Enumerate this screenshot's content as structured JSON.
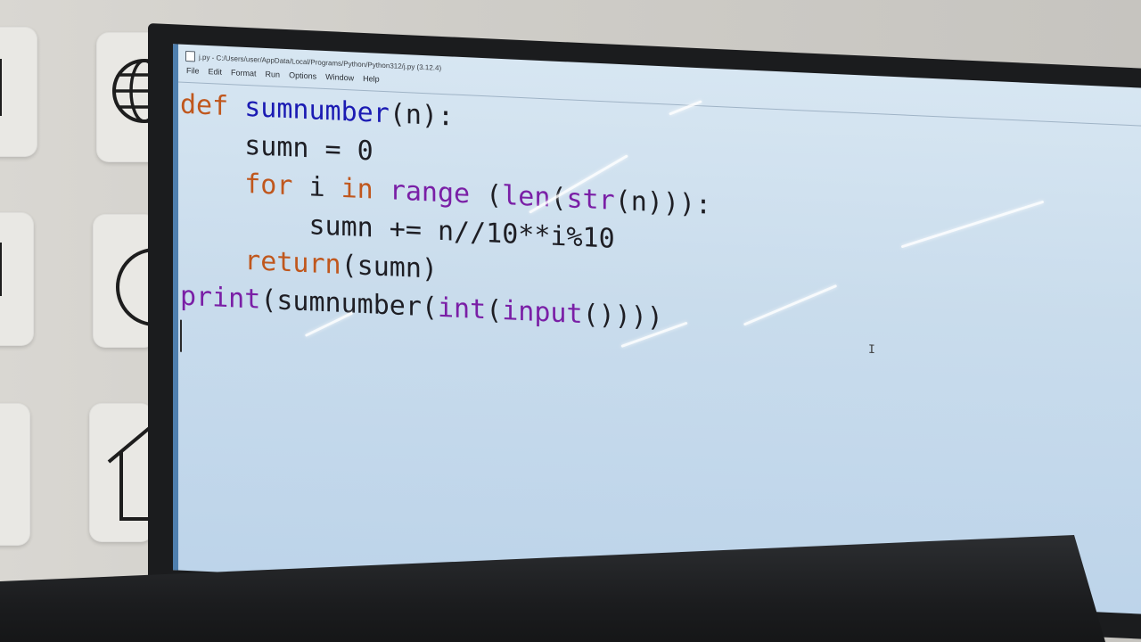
{
  "window": {
    "title": "j.py - C:/Users/user/AppData/Local/Programs/Python/Python312/j.py (3.12.4)"
  },
  "menu": {
    "items": [
      "File",
      "Edit",
      "Format",
      "Run",
      "Options",
      "Window",
      "Help"
    ]
  },
  "editor": {
    "lines": [
      [
        {
          "t": "def",
          "c": "kw"
        },
        {
          "t": " "
        },
        {
          "t": "sumnumber",
          "c": "fn"
        },
        {
          "t": "(n):"
        }
      ],
      [
        {
          "t": "    sumn = 0"
        }
      ],
      [
        {
          "t": "    "
        },
        {
          "t": "for",
          "c": "kw"
        },
        {
          "t": " i "
        },
        {
          "t": "in",
          "c": "kw"
        },
        {
          "t": " "
        },
        {
          "t": "range",
          "c": "bi"
        },
        {
          "t": " ("
        },
        {
          "t": "len",
          "c": "bi"
        },
        {
          "t": "("
        },
        {
          "t": "str",
          "c": "bi"
        },
        {
          "t": "(n))):"
        }
      ],
      [
        {
          "t": "        sumn += n//10**i%10"
        }
      ],
      [
        {
          "t": "    "
        },
        {
          "t": "return",
          "c": "kw"
        },
        {
          "t": "(sumn)"
        }
      ],
      [
        {
          "t": "print",
          "c": "bi"
        },
        {
          "t": "(sumnumber("
        },
        {
          "t": "int",
          "c": "bi"
        },
        {
          "t": "("
        },
        {
          "t": "input",
          "c": "bi"
        },
        {
          "t": "())))"
        }
      ]
    ]
  },
  "colors": {
    "keyword": "#c0571d",
    "definition": "#1b1bb3",
    "builtin": "#7a1fa6",
    "screen_bg": "#c9dcec"
  }
}
